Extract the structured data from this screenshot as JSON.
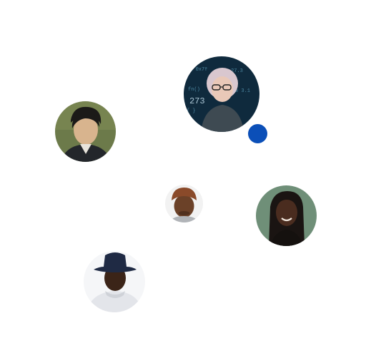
{
  "avatars": [
    {
      "id": "hacker",
      "bg": "#0f2a3d",
      "skin": "#e9c8b8",
      "hair": "#d9c7cf"
    },
    {
      "id": "man-left",
      "bg": "#6c7a4a",
      "skin": "#d8b48e",
      "hair": "#1b1a18"
    },
    {
      "id": "beanie",
      "bg": "#f2f2f2",
      "skin": "#6b4128",
      "hat": "#8a4a2a"
    },
    {
      "id": "woman",
      "bg": "#6f8f78",
      "skin": "#4a2c1f",
      "hair": "#1a1412"
    },
    {
      "id": "bucket",
      "bg": "#f5f6f8",
      "skin": "#3b2418",
      "hat": "#1f2a44"
    }
  ],
  "status_dot": {
    "color": "#0b4fb8"
  }
}
